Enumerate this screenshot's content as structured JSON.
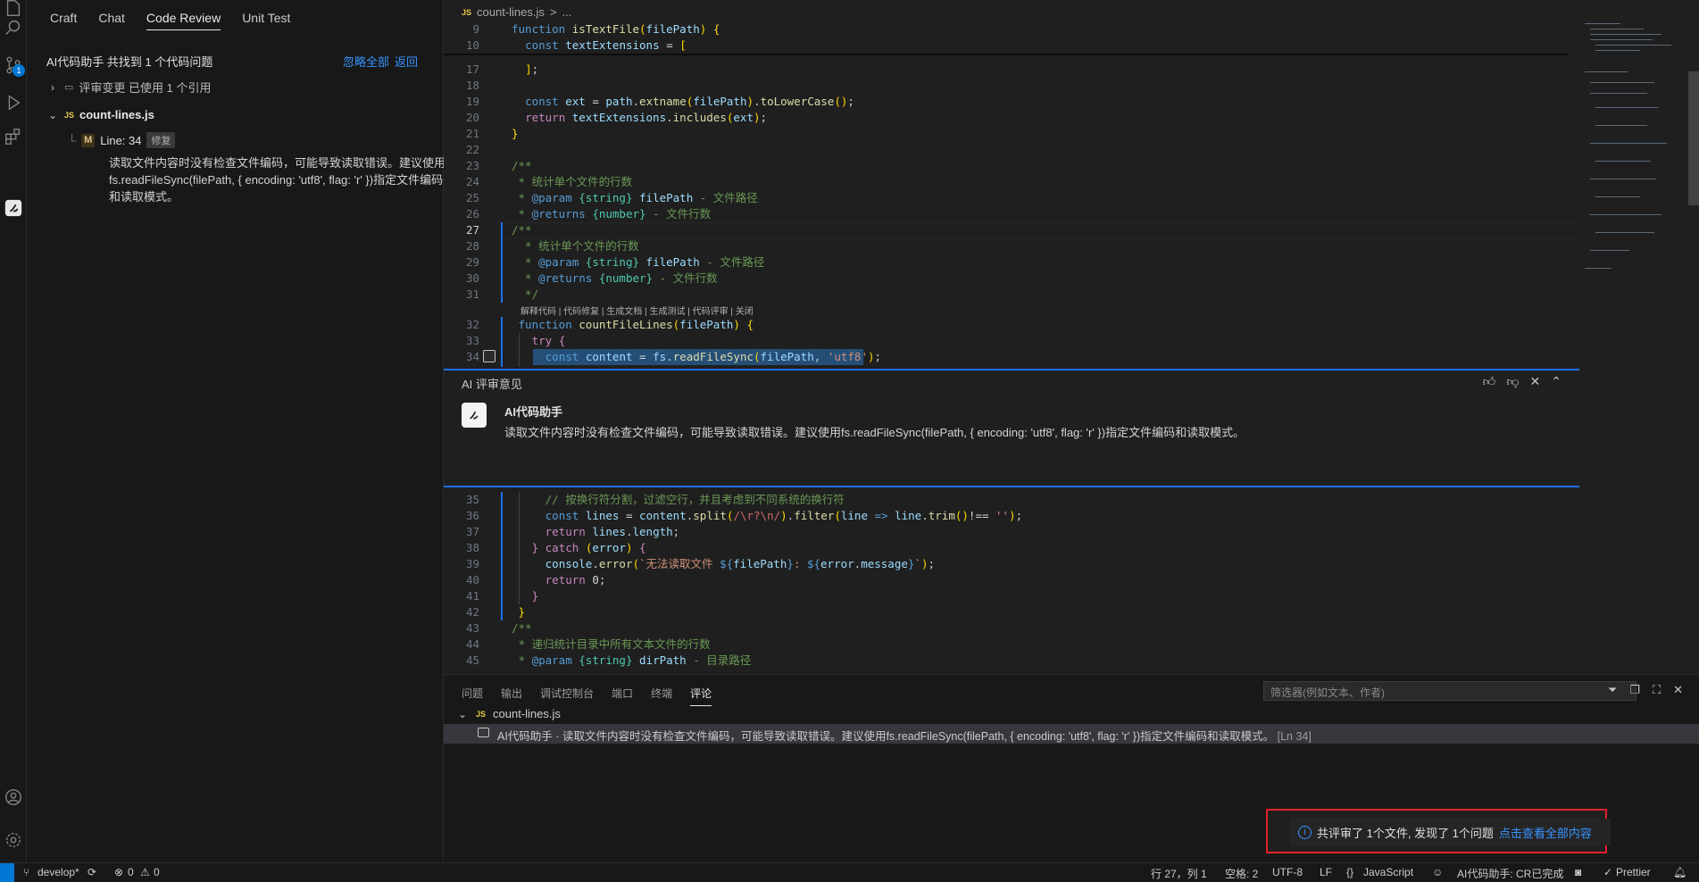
{
  "activity": {
    "scm_badge": "1"
  },
  "side": {
    "tabs": [
      "Craft",
      "Chat",
      "Code Review",
      "Unit Test"
    ],
    "summary": "AI代码助手 共找到 1 个代码问题",
    "ignore_all": "忽略全部",
    "back": "返回",
    "ref_row": "评审变更 已使用 1 个引用",
    "file": {
      "icon": "JS",
      "name": "count-lines.js"
    },
    "issue": {
      "mark": "M",
      "line": "Line: 34",
      "tag": "修复",
      "text": "读取文件内容时没有检查文件编码，可能导致读取错误。建议使用fs.readFileSync(filePath, { encoding: 'utf8', flag: 'r' })指定文件编码和读取模式。"
    }
  },
  "editor": {
    "breadcrumb": {
      "icon": "JS",
      "file": "count-lines.js",
      "sep": ">",
      "more": "..."
    },
    "codelens": "解释代码 | 代码修复 | 生成文档 | 生成测试 | 代码评审 | 关闭",
    "zone": {
      "title": "AI 评审意见",
      "author": "AI代码助手",
      "text": "读取文件内容时没有检查文件编码，可能导致读取错误。建议使用fs.readFileSync(filePath, { encoding: 'utf8', flag: 'r' })指定文件编码和读取模式。"
    }
  },
  "panel": {
    "tabs": [
      "问题",
      "输出",
      "调试控制台",
      "端口",
      "终端",
      "评论"
    ],
    "active_tab": "评论",
    "filter_placeholder": "筛选器(例如文本、作者)",
    "file": "count-lines.js",
    "comment_author": "AI代码助手",
    "comment_text": "读取文件内容时没有检查文件编码，可能导致读取错误。建议使用fs.readFileSync(filePath, { encoding: 'utf8', flag: 'r' })指定文件编码和读取模式。",
    "comment_ref": "[Ln 34]"
  },
  "notification": {
    "text": "共评审了 1个文件, 发现了 1个问题",
    "link": "点击查看全部内容"
  },
  "status": {
    "branch": "develop*",
    "errors": "0",
    "warnings": "0",
    "position": "行 27，列 1",
    "spaces": "空格: 2",
    "encoding": "UTF-8",
    "eol": "LF",
    "language": "JavaScript",
    "assistant": "AI代码助手: CR已完成",
    "prettier": "Prettier"
  },
  "colors": {
    "accent": "#0078d4",
    "highlight_border": "#e0212a",
    "link": "#3794ff"
  }
}
